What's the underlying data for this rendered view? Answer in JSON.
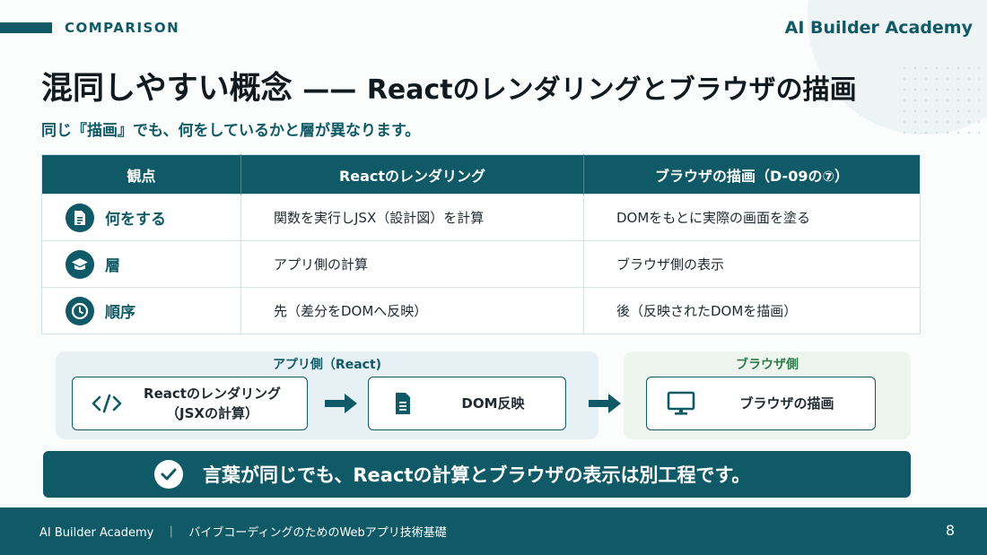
{
  "header": {
    "section_label": "COMPARISON",
    "brand": "AI Builder Academy"
  },
  "title": {
    "main": "混同しやすい概念",
    "dash": "——",
    "sub": "Reactのレンダリングとブラウザの描画"
  },
  "subtitle": "同じ『描画』でも、何をしているかと層が異なります。",
  "table": {
    "headers": [
      "観点",
      "Reactのレンダリング",
      "ブラウザの描画（D-09の⑦）"
    ],
    "rows": [
      {
        "icon": "document-icon",
        "label": "何をする",
        "react": "関数を実行しJSX（設計図）を計算",
        "browser": "DOMをもとに実際の画面を塗る"
      },
      {
        "icon": "layers-icon",
        "label": "層",
        "react": "アプリ側の計算",
        "browser": "ブラウザ側の表示"
      },
      {
        "icon": "clock-icon",
        "label": "順序",
        "react": "先（差分をDOMへ反映）",
        "browser": "後（反映されたDOMを描画）"
      }
    ]
  },
  "flow": {
    "app_label": "アプリ側（React)",
    "browser_label": "ブラウザ側",
    "step1_line1": "Reactのレンダリング",
    "step1_line2": "（JSXの計算）",
    "step2": "DOM反映",
    "step3": "ブラウザの描画"
  },
  "conclusion": "言葉が同じでも、Reactの計算とブラウザの表示は別工程です。",
  "footer": {
    "text": "AI Builder Academy　｜　バイブコーディングのためのWebアプリ技術基礎",
    "page": "8"
  },
  "colors": {
    "primary": "#0f5a66",
    "browser_green": "#2f7a4c"
  }
}
